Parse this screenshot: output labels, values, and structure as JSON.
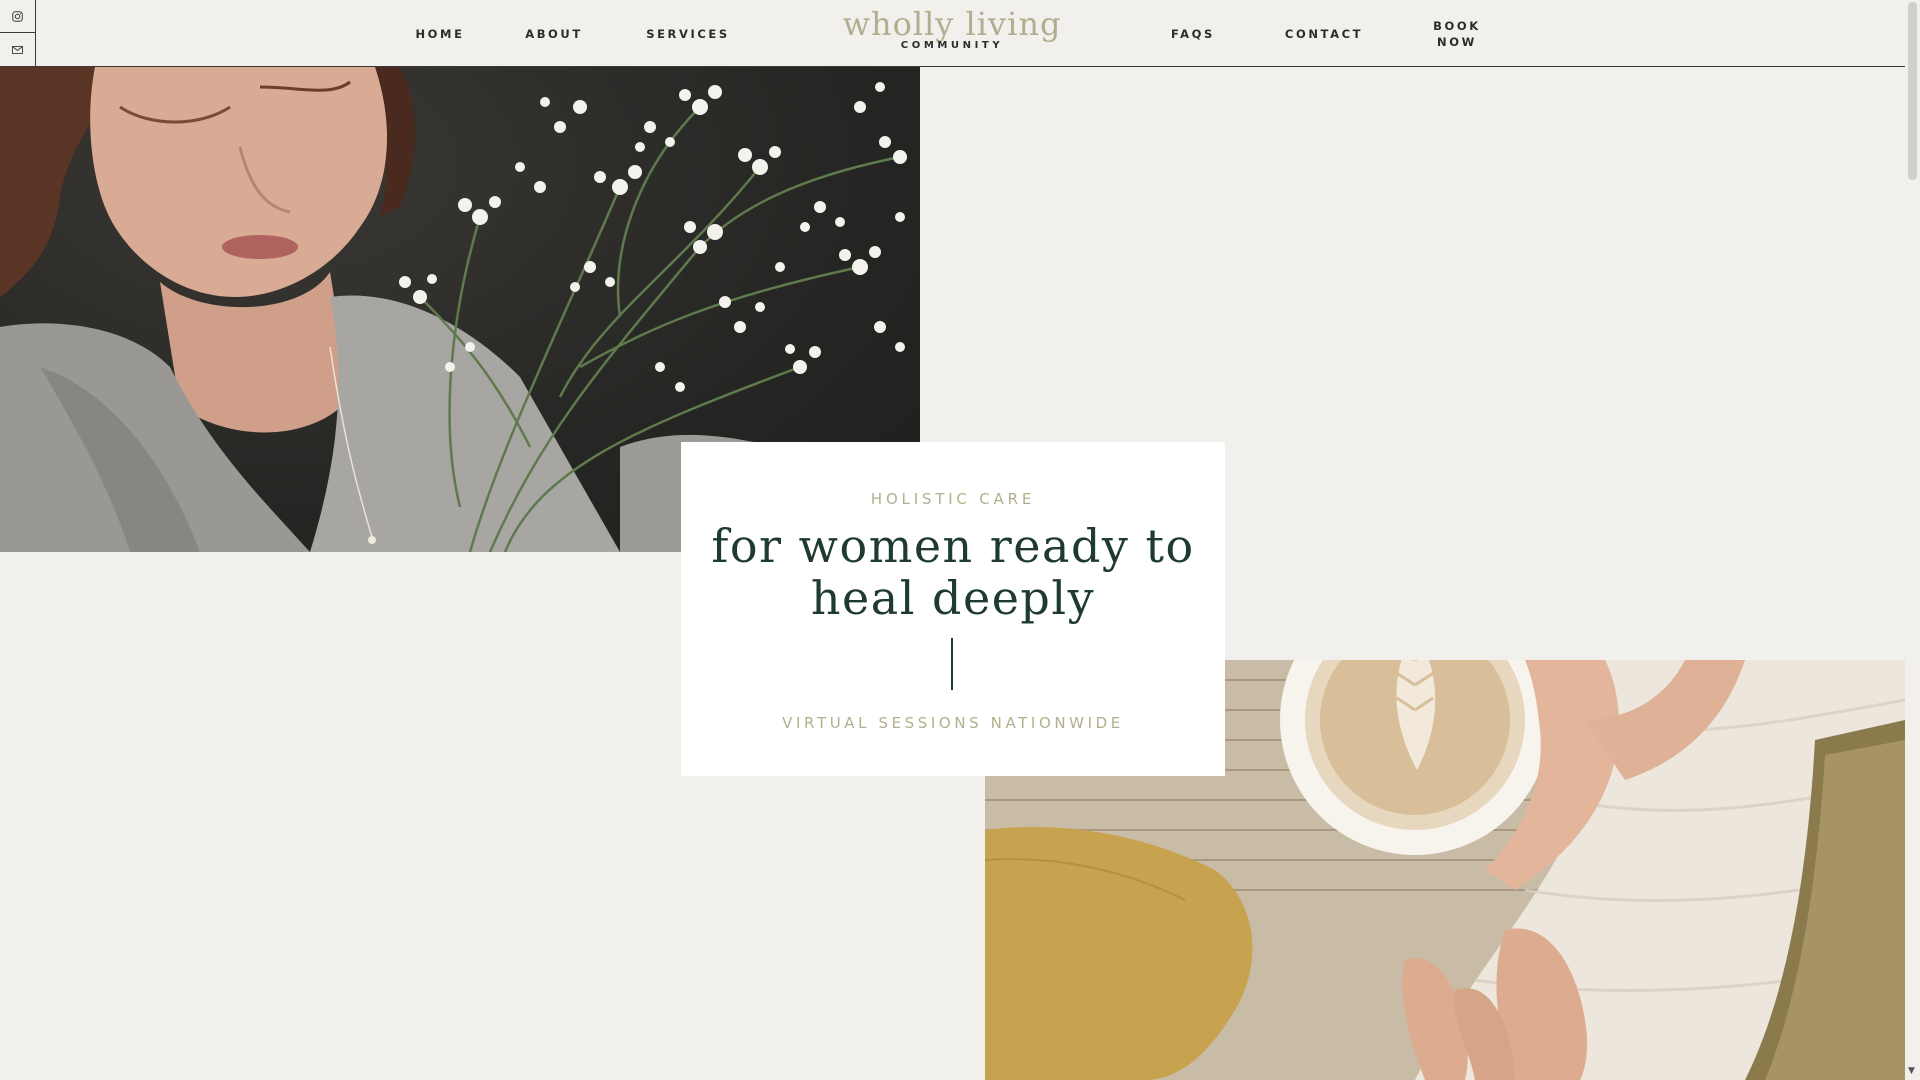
{
  "social": {
    "icons": [
      "instagram-icon",
      "email-icon"
    ]
  },
  "nav": {
    "home": "HOME",
    "about": "ABOUT",
    "services": "SERVICES",
    "faqs": "FAQS",
    "contact": "CONTACT",
    "book_line1": "BOOK",
    "book_line2": "NOW"
  },
  "logo": {
    "main": "wholly living",
    "sub": "COMMUNITY"
  },
  "hero": {
    "eyebrow": "HOLISTIC CARE",
    "headline_line1": "for women ready to",
    "headline_line2": "heal deeply",
    "footer": "VIRTUAL SESSIONS NATIONWIDE"
  },
  "colors": {
    "background": "#f2f0ec",
    "accent_sage": "#b2b08c",
    "deep_green": "#1e3a33",
    "card": "#ffffff"
  }
}
